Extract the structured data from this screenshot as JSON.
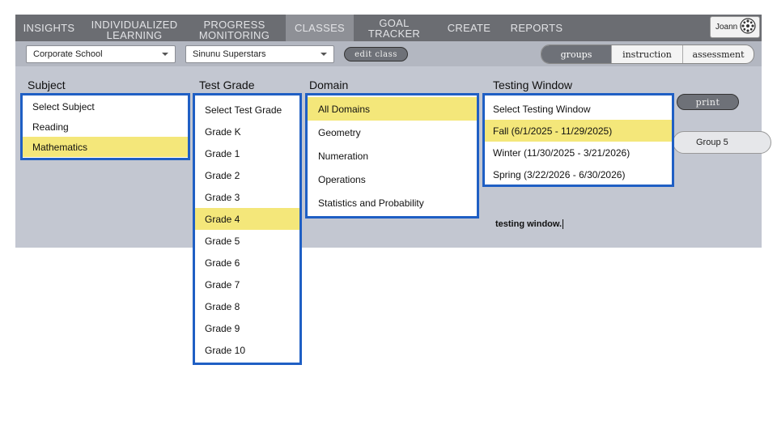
{
  "nav": {
    "items": [
      {
        "label": "INSIGHTS"
      },
      {
        "label": "INDIVIDUALIZED LEARNING"
      },
      {
        "label": "PROGRESS MONITORING"
      },
      {
        "label": "CLASSES"
      },
      {
        "label": "GOAL TRACKER"
      },
      {
        "label": "CREATE"
      },
      {
        "label": "REPORTS"
      }
    ],
    "active": "CLASSES",
    "user_name": "Joann"
  },
  "toolbar": {
    "school_select": "Corporate School",
    "class_select": "Sinunu Superstars",
    "edit_class_label": "edit class",
    "segments": [
      "groups",
      "instruction",
      "assessment"
    ],
    "active_segment": "groups"
  },
  "filters": {
    "subject": {
      "label": "Subject",
      "options": [
        "Select Subject",
        "Reading",
        "Mathematics"
      ],
      "selected": "Mathematics"
    },
    "test_grade": {
      "label": "Test Grade",
      "options": [
        "Select Test Grade",
        "Grade K",
        "Grade 1",
        "Grade 2",
        "Grade 3",
        "Grade 4",
        "Grade 5",
        "Grade 6",
        "Grade 7",
        "Grade 8",
        "Grade 9",
        "Grade 10"
      ],
      "selected": "Grade 4"
    },
    "domain": {
      "label": "Domain",
      "options": [
        "All Domains",
        "Geometry",
        "Numeration",
        "Operations",
        "Statistics and Probability"
      ],
      "selected": "All Domains"
    },
    "testing_window": {
      "label": "Testing Window",
      "options": [
        "Select Testing Window",
        "Fall (6/1/2025 - 11/29/2025)",
        "Winter (11/30/2025 - 3/21/2026)",
        "Spring (3/22/2026 - 6/30/2026)"
      ],
      "selected": "Fall (6/1/2025 - 11/29/2025)"
    }
  },
  "print_label": "print",
  "group_label": "Group 5",
  "testing_text": "testing window.",
  "colors": {
    "nav_bg": "#6b6d72",
    "highlight": "#f4e77a",
    "dropdown_border": "#1f5fc4",
    "panel_bg": "#c3c7d1"
  }
}
